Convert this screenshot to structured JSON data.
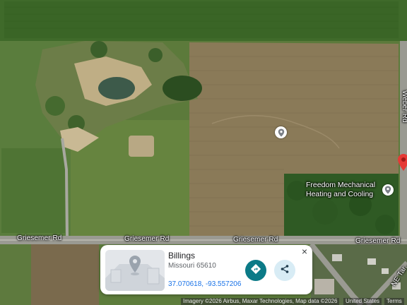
{
  "map": {
    "view": "satellite",
    "roads": {
      "griesemer_1": "Griesemer Rd",
      "griesemer_2": "Griesemer Rd",
      "griesemer_3": "Griesemer Rd",
      "griesemer_4": "Griesemer Rd",
      "weber": "Weber Rd",
      "ne_tanner": "NE Tar..."
    },
    "poi": {
      "name_line1": "Freedom Mechanical",
      "name_line2": "Heating and Cooling",
      "icon": "location-pin-icon"
    },
    "dropped_pin_color": "#e53935"
  },
  "card": {
    "title": "Billings",
    "subtitle": "Missouri 65610",
    "coordinates": "37.070618, -93.557206",
    "close": "×",
    "directions_icon": "directions-icon",
    "share_icon": "share-icon",
    "accent": "#0b7a87"
  },
  "attribution": {
    "imagery": "Imagery ©2026 Airbus, Maxar Technologies, Map data ©2026",
    "country": "United States",
    "terms": "Terms"
  }
}
